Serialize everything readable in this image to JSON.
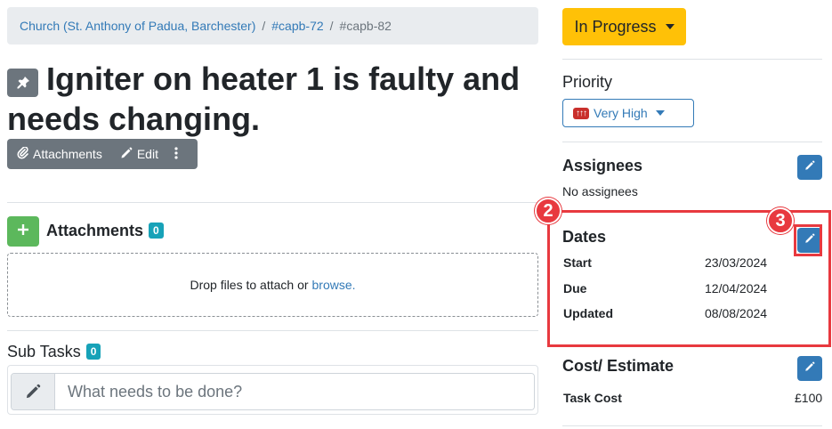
{
  "breadcrumb": {
    "items": [
      "Church (St. Anthony of Padua, Barchester)",
      "#capb-72"
    ],
    "current": "#capb-82",
    "separator": "/"
  },
  "task": {
    "title": "Igniter on heater 1 is faulty and needs changing.",
    "pin_icon": "pin-icon"
  },
  "toolbar": {
    "attachments_label": "Attachments",
    "edit_label": "Edit",
    "more_icon": "kebab-icon"
  },
  "attachments": {
    "heading": "Attachments",
    "count": "0",
    "drop_text": "Drop files to attach or",
    "browse_link": "browse."
  },
  "subtasks": {
    "heading": "Sub Tasks",
    "count": "0",
    "placeholder": "What needs to be done?"
  },
  "status": {
    "label": "In Progress",
    "color": "#ffc107"
  },
  "priority": {
    "heading": "Priority",
    "arrows": "↑↑↑",
    "label": "Very High"
  },
  "assignees": {
    "heading": "Assignees",
    "empty_text": "No assignees"
  },
  "dates": {
    "heading": "Dates",
    "rows": [
      {
        "key": "Start",
        "value": "23/03/2024"
      },
      {
        "key": "Due",
        "value": "12/04/2024"
      },
      {
        "key": "Updated",
        "value": "08/08/2024"
      }
    ]
  },
  "cost": {
    "heading": "Cost/ Estimate",
    "rows": [
      {
        "key": "Task Cost",
        "value": "£100"
      }
    ]
  },
  "annotations": {
    "step_2": "2",
    "step_3": "3",
    "color": "#e8393f"
  },
  "colors": {
    "link": "#337ab7",
    "success": "#5cb85c",
    "info_badge": "#17a2b8",
    "danger": "#c9302c"
  }
}
